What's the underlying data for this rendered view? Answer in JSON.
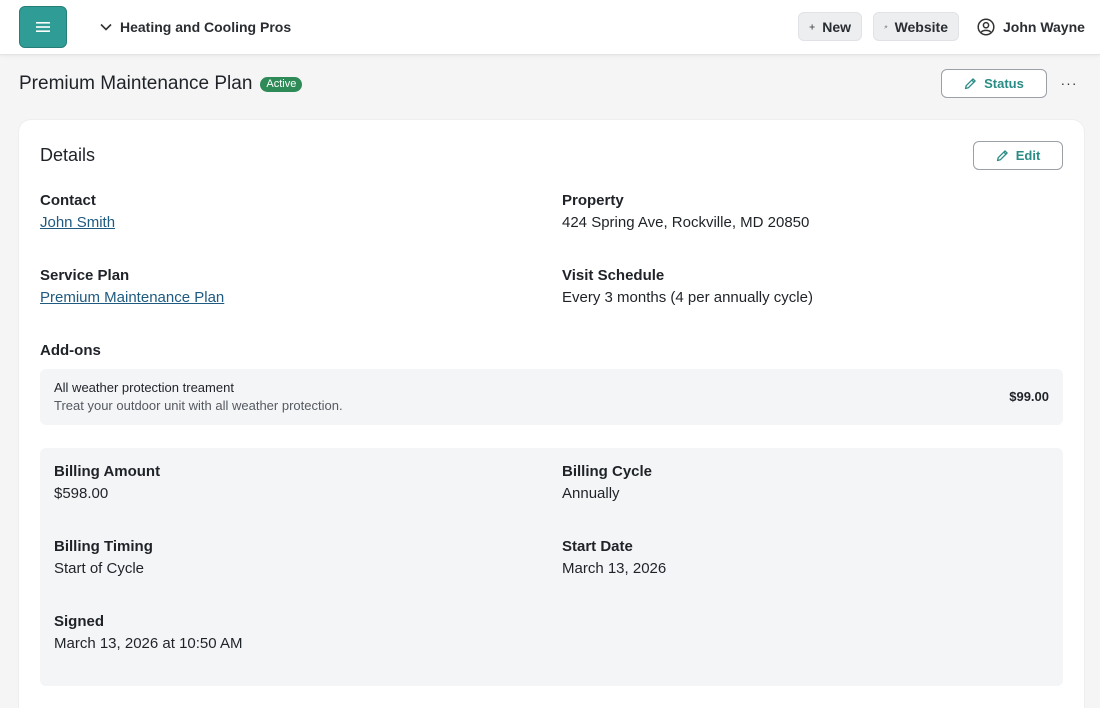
{
  "topbar": {
    "company": "Heating and Cooling Pros",
    "new_label": "New",
    "website_label": "Website",
    "user_name": "John Wayne"
  },
  "page": {
    "title": "Premium Maintenance Plan",
    "status_badge": "Active",
    "status_button": "Status",
    "more": "···"
  },
  "details": {
    "title": "Details",
    "edit_label": "Edit",
    "contact_label": "Contact",
    "contact_value": "John Smith",
    "property_label": "Property",
    "property_value": "424 Spring Ave, Rockville, MD 20850",
    "service_plan_label": "Service Plan",
    "service_plan_value": "Premium Maintenance Plan",
    "visit_schedule_label": "Visit Schedule",
    "visit_schedule_value": "Every 3 months (4 per annually cycle)",
    "addons_label": "Add-ons",
    "addons": [
      {
        "name": "All weather protection treament",
        "description": "Treat your outdoor unit with all weather protection.",
        "price": "$99.00"
      }
    ]
  },
  "billing": {
    "amount_label": "Billing Amount",
    "amount_value": "$598.00",
    "cycle_label": "Billing Cycle",
    "cycle_value": "Annually",
    "timing_label": "Billing Timing",
    "timing_value": "Start of Cycle",
    "start_label": "Start Date",
    "start_value": "March 13, 2026",
    "signed_label": "Signed",
    "signed_value": "March 13, 2026 at 10:50 AM"
  },
  "colors": {
    "accent": "#2f9d95",
    "badge": "#2e8b57",
    "link": "#1f5a80"
  },
  "icons": [
    "hamburger-icon",
    "chevron-down-icon",
    "plus-icon",
    "sparkle-icon",
    "user-circle-icon",
    "pencil-icon",
    "ellipsis-icon"
  ]
}
